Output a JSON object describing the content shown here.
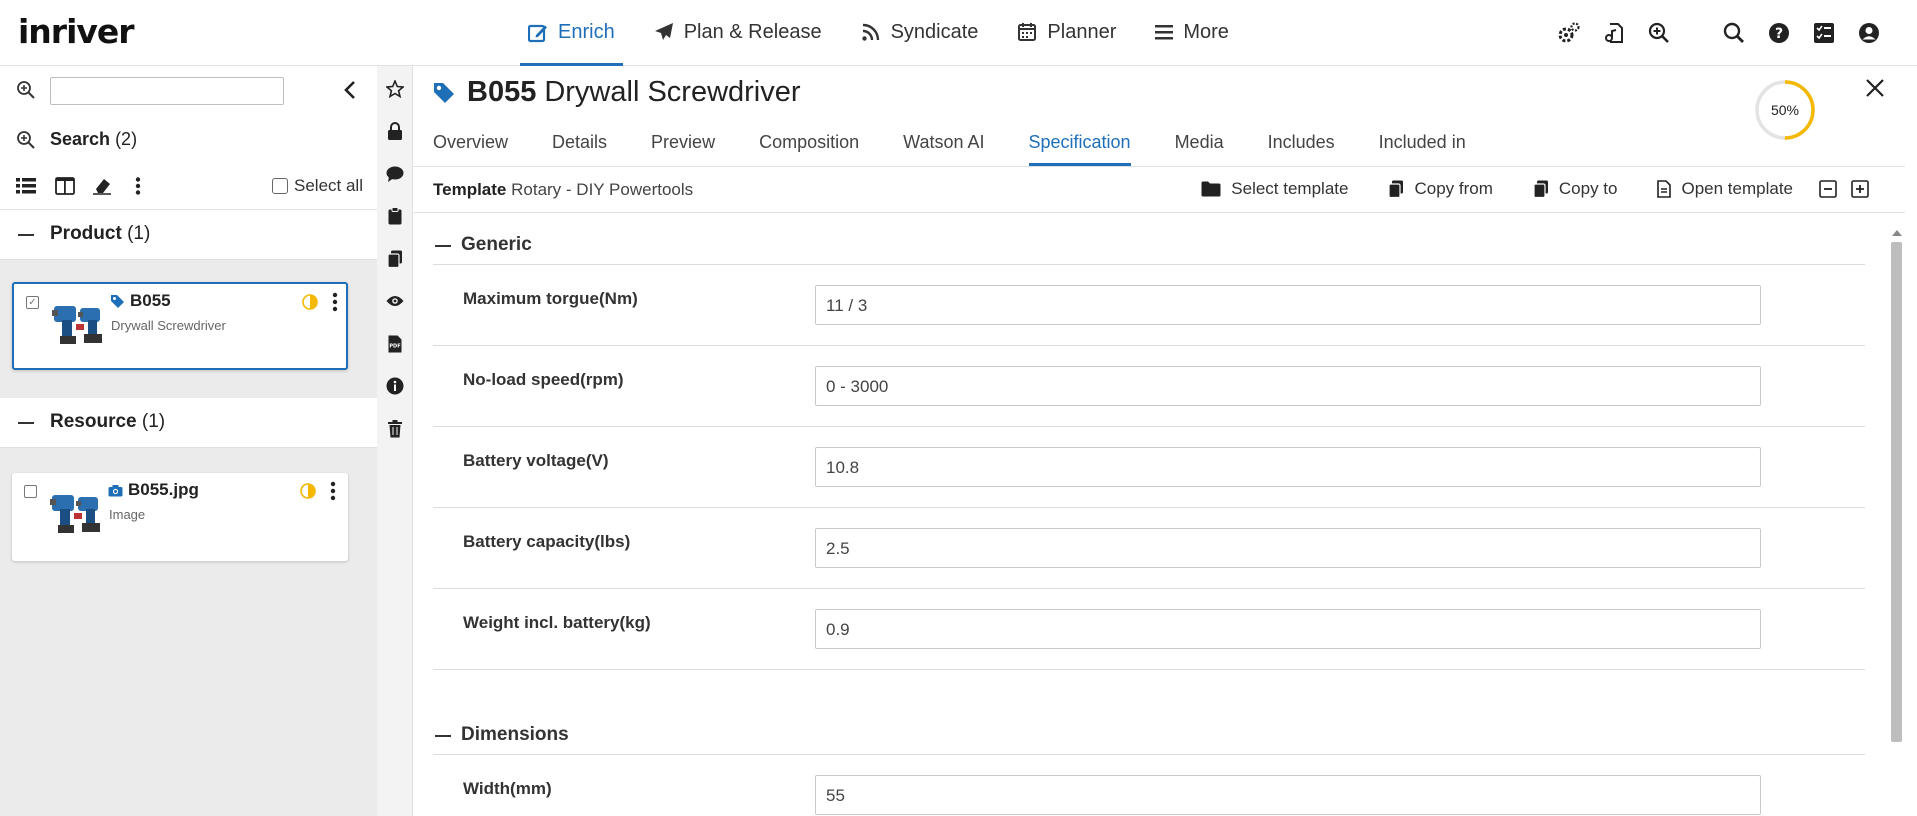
{
  "app": {
    "logo": "inriver"
  },
  "topnav": [
    {
      "label": "Enrich",
      "icon": "edit-icon",
      "active": true
    },
    {
      "label": "Plan & Release",
      "icon": "paper-plane-icon",
      "active": false
    },
    {
      "label": "Syndicate",
      "icon": "rss-icon",
      "active": false
    },
    {
      "label": "Planner",
      "icon": "calendar-icon",
      "active": false
    },
    {
      "label": "More",
      "icon": "hamburger-icon",
      "active": false
    }
  ],
  "top_right_icons": [
    "settings-icon",
    "file-music-icon",
    "zoom-in-icon",
    "search-icon",
    "help-icon",
    "tasks-icon",
    "user-icon"
  ],
  "left": {
    "search_input_value": "",
    "search_label": "Search",
    "search_count": "(2)",
    "select_all": "Select all",
    "sections": {
      "product": {
        "title": "Product",
        "count": "(1)"
      },
      "resource": {
        "title": "Resource",
        "count": "(1)"
      }
    },
    "cards": {
      "product": {
        "name": "B055",
        "sub": "Drywall Screwdriver",
        "checked": true
      },
      "resource": {
        "name": "B055.jpg",
        "sub": "Image",
        "checked": false
      }
    }
  },
  "rail_icons": [
    "star-icon",
    "lock-icon",
    "comment-icon",
    "clipboard-icon",
    "copy-icon",
    "eye-icon",
    "pdf-icon",
    "info-icon",
    "trash-icon"
  ],
  "entity": {
    "code": "B055",
    "name": "Drywall Screwdriver",
    "completeness": "50%",
    "completeness_value": 0.5
  },
  "tabs": [
    "Overview",
    "Details",
    "Preview",
    "Composition",
    "Watson AI",
    "Specification",
    "Media",
    "Includes",
    "Included in"
  ],
  "active_tab": "Specification",
  "template": {
    "label": "Template",
    "value": "Rotary - DIY Powertools"
  },
  "actions": {
    "select_template": "Select template",
    "copy_from": "Copy from",
    "copy_to": "Copy to",
    "open_template": "Open template"
  },
  "groups": {
    "generic": {
      "title": "Generic",
      "fields": [
        {
          "label": "Maximum torgue(Nm)",
          "value": "11 / 3"
        },
        {
          "label": "No-load speed(rpm)",
          "value": "0 - 3000"
        },
        {
          "label": "Battery voltage(V)",
          "value": "10.8"
        },
        {
          "label": "Battery capacity(lbs)",
          "value": "2.5"
        },
        {
          "label": "Weight incl. battery(kg)",
          "value": "0.9"
        }
      ]
    },
    "dimensions": {
      "title": "Dimensions",
      "fields": [
        {
          "label": "Width(mm)",
          "value": "55"
        }
      ]
    }
  },
  "colors": {
    "accent": "#1e6fb8",
    "warning": "#f5b800"
  }
}
